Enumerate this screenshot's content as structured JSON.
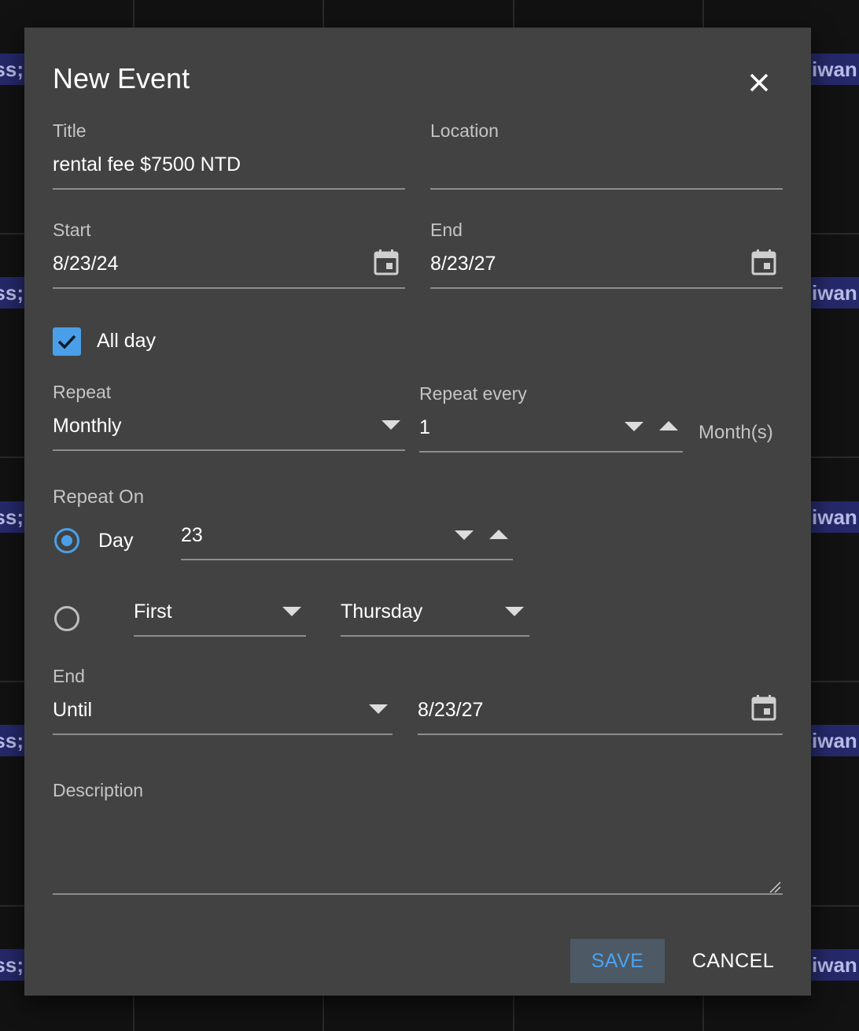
{
  "background": {
    "event_left_text": "ss;",
    "event_right_text": "iwan"
  },
  "dialog": {
    "title": "New Event",
    "close_icon": "close-icon",
    "fields": {
      "title_label": "Title",
      "title_value": "rental fee $7500 NTD",
      "location_label": "Location",
      "location_value": "",
      "start_label": "Start",
      "start_value": "8/23/24",
      "end_label": "End",
      "end_value": "8/23/27",
      "all_day_label": "All day",
      "all_day_checked": true,
      "repeat_label": "Repeat",
      "repeat_value": "Monthly",
      "repeat_every_label": "Repeat every",
      "repeat_every_value": "1",
      "repeat_every_unit": "Month(s)",
      "repeat_on_label": "Repeat On",
      "day_option_label": "Day",
      "day_value": "23",
      "week_ordinal_value": "First",
      "weekday_value": "Thursday",
      "end_rule_label": "End",
      "end_rule_value": "Until",
      "end_rule_date": "8/23/27",
      "description_label": "Description",
      "description_value": ""
    },
    "actions": {
      "save_label": "SAVE",
      "cancel_label": "CANCEL"
    }
  },
  "colors": {
    "dialog_bg": "#424242",
    "accent": "#4a9fe8",
    "text_primary": "#ffffff",
    "text_secondary": "#c4c4c4"
  }
}
